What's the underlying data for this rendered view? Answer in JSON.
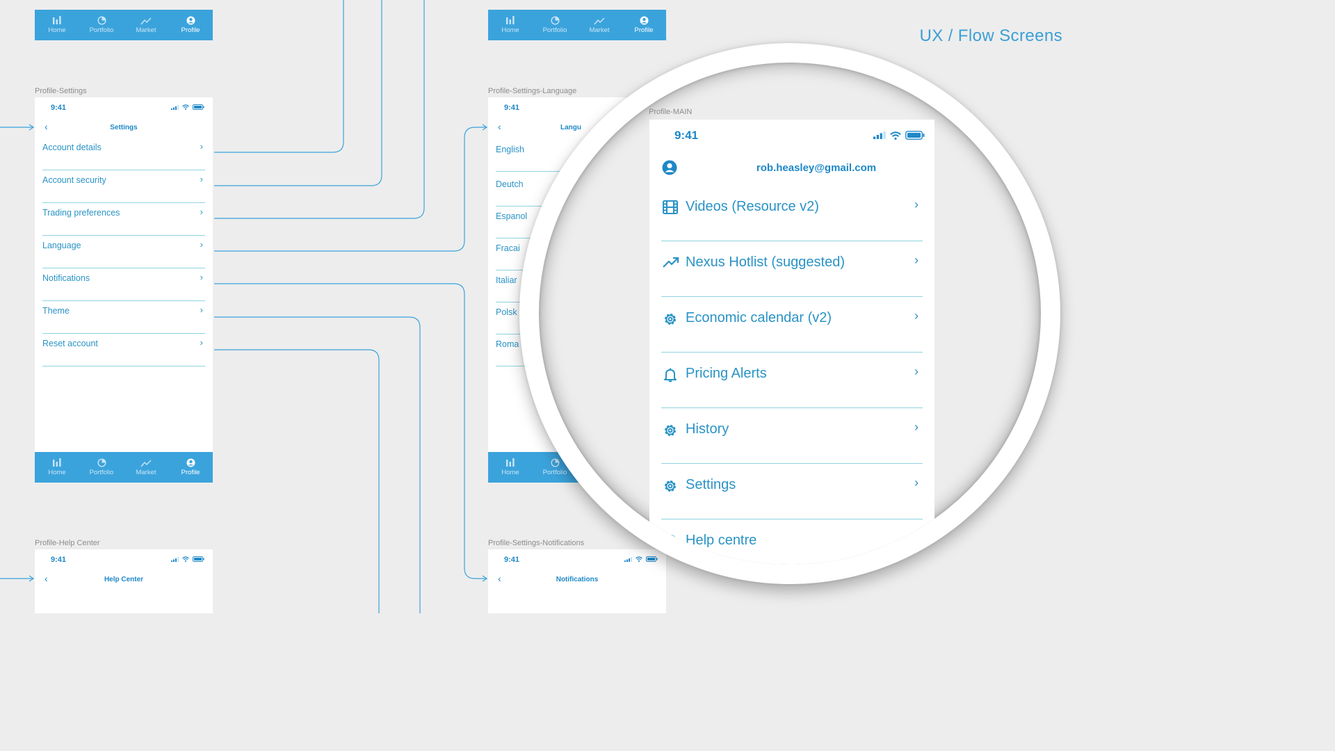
{
  "heading": "UX / Flow Screens",
  "colors": {
    "accent": "#3ba3dc",
    "text": "#2a93c6",
    "divider": "#8fd3e0",
    "canvas": "#ededed"
  },
  "tabs": [
    {
      "label": "Home",
      "icon": "home-icon"
    },
    {
      "label": "Portfolio",
      "icon": "portfolio-pie-icon"
    },
    {
      "label": "Market",
      "icon": "market-trend-icon"
    },
    {
      "label": "Profile",
      "icon": "profile-user-icon"
    }
  ],
  "frames": {
    "settings": {
      "label": "Profile-Settings",
      "time": "9:41",
      "back": "‹",
      "title": "Settings",
      "items": [
        "Account details",
        "Account security",
        "Trading preferences",
        "Language",
        "Notifications",
        "Theme",
        "Reset account"
      ]
    },
    "language": {
      "label": "Profile-Settings-Language",
      "time": "9:41",
      "back": "‹",
      "title": "Langu",
      "items": [
        "English",
        "Deutch",
        "Espanol",
        "Fracai",
        "Italiar",
        "Polsk",
        "Roma"
      ]
    },
    "help": {
      "label": "Profile-Help Center",
      "time": "9:41",
      "back": "‹",
      "title": "Help Center"
    },
    "notifications": {
      "label": "Profile-Settings-Notifications",
      "time": "9:41",
      "back": "‹",
      "title": "Notifications"
    },
    "main": {
      "label": "Profile-MAIN",
      "time": "9:41",
      "email": "rob.heasley@gmail.com",
      "items": [
        {
          "label": "Videos (Resource v2)",
          "icon": "film-icon"
        },
        {
          "label": "Nexus Hotlist (suggested)",
          "icon": "trending-up-icon"
        },
        {
          "label": "Economic calendar (v2)",
          "icon": "gear-icon"
        },
        {
          "label": "Pricing Alerts",
          "icon": "bell-icon"
        },
        {
          "label": "History",
          "icon": "gear-icon"
        },
        {
          "label": "Settings",
          "icon": "gear-icon"
        },
        {
          "label": "Help centre",
          "icon": "help-icon"
        }
      ],
      "chevron": "›"
    }
  }
}
